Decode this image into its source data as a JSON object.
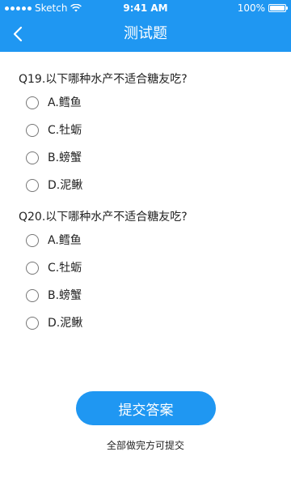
{
  "status_bar": {
    "carrier": "Sketch",
    "time": "9:41 AM",
    "battery": "100%",
    "battery_level": 1.0
  },
  "nav": {
    "title": "测试题",
    "back_icon": "chevron-left-icon"
  },
  "questions": [
    {
      "title": "Q19.以下哪种水产不适合糖友吃?",
      "options": [
        "A.鳕鱼",
        "C.牡蛎",
        "B.螃蟹",
        "D.泥鳅"
      ]
    },
    {
      "title": "Q20.以下哪种水产不适合糖友吃?",
      "options": [
        "A.鳕鱼",
        "C.牡蛎",
        "B.螃蟹",
        "D.泥鳅"
      ]
    }
  ],
  "submit": {
    "label": "提交答案",
    "hint": "全部做完方可提交"
  },
  "colors": {
    "primary": "#1f97f2",
    "text": "#222222",
    "radio_border": "#777777"
  }
}
